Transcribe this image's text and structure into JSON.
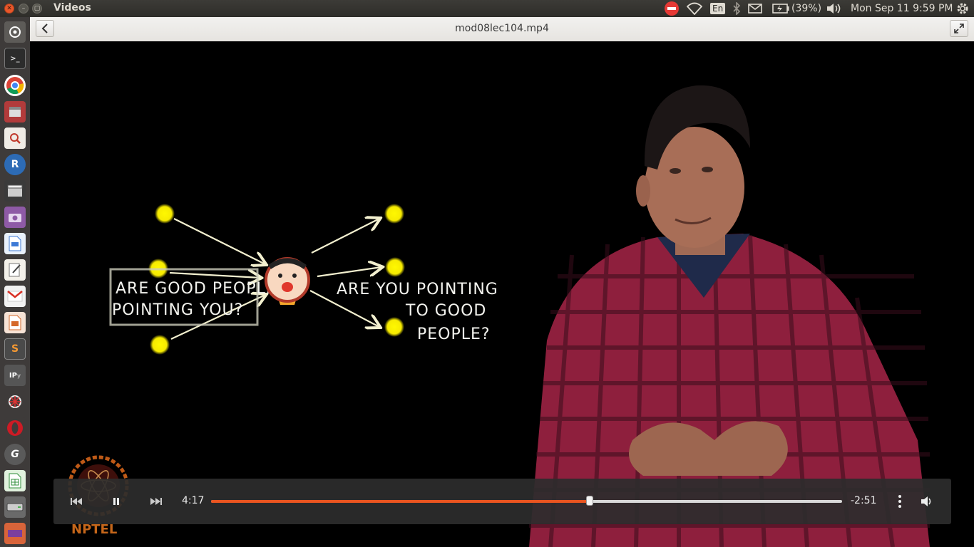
{
  "app": {
    "title": "Videos"
  },
  "panel": {
    "keyboard": "En",
    "battery": "(39%)",
    "datetime": "Mon Sep 11  9:59 PM"
  },
  "header": {
    "file_name": "mod08lec104.mp4"
  },
  "slide": {
    "left_text_line1": "ARE GOOD PEOPLE",
    "left_text_line2": "POINTING YOU?",
    "right_text_line1": "ARE YOU POINTING",
    "right_text_line2": "TO GOOD",
    "right_text_line3": "PEOPLE?"
  },
  "watermark": {
    "label": "NPTEL"
  },
  "player": {
    "elapsed": "4:17",
    "remaining": "-2:51",
    "progress_fraction": 0.6
  },
  "launcher": {
    "items": [
      "dash-home",
      "terminal",
      "chrome",
      "files-archive",
      "document-viewer",
      "r-language",
      "video-editor",
      "screenshot",
      "libreoffice-writer",
      "text-editor",
      "gmail",
      "presentation",
      "sublime-text",
      "ipython",
      "settings-tool",
      "opera",
      "geogebra",
      "spreadsheet",
      "drive",
      "software-updater"
    ]
  },
  "colors": {
    "accent": "#e95420",
    "panel_bg": "#3c3b37",
    "launcher_bg": "#3e3b3a"
  }
}
